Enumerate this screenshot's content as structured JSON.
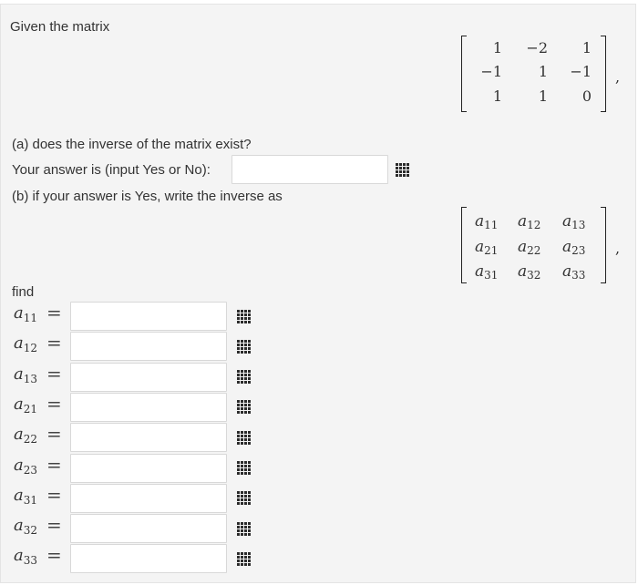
{
  "prompt": "Given the matrix",
  "matrix": {
    "rows": [
      [
        "1",
        "−2",
        "1"
      ],
      [
        "−1",
        "1",
        "−1"
      ],
      [
        "1",
        "1",
        "0"
      ]
    ],
    "trailing": ","
  },
  "part_a": {
    "question": "(a) does the inverse of the matrix exist?",
    "label": "Your answer is (input Yes or No):",
    "value": ""
  },
  "part_b": {
    "text": "(b) if your answer is Yes, write the inverse as"
  },
  "inverse_matrix": {
    "rows": [
      [
        {
          "b": "a",
          "s": "11"
        },
        {
          "b": "a",
          "s": "12"
        },
        {
          "b": "a",
          "s": "13"
        }
      ],
      [
        {
          "b": "a",
          "s": "21"
        },
        {
          "b": "a",
          "s": "22"
        },
        {
          "b": "a",
          "s": "23"
        }
      ],
      [
        {
          "b": "a",
          "s": "31"
        },
        {
          "b": "a",
          "s": "32"
        },
        {
          "b": "a",
          "s": "33"
        }
      ]
    ],
    "trailing": ","
  },
  "find_label": "find",
  "entries": [
    {
      "base": "a",
      "sub": "11",
      "eq": "=",
      "value": ""
    },
    {
      "base": "a",
      "sub": "12",
      "eq": "=",
      "value": ""
    },
    {
      "base": "a",
      "sub": "13",
      "eq": "=",
      "value": ""
    },
    {
      "base": "a",
      "sub": "21",
      "eq": "=",
      "value": ""
    },
    {
      "base": "a",
      "sub": "22",
      "eq": "=",
      "value": ""
    },
    {
      "base": "a",
      "sub": "23",
      "eq": "=",
      "value": ""
    },
    {
      "base": "a",
      "sub": "31",
      "eq": "=",
      "value": ""
    },
    {
      "base": "a",
      "sub": "32",
      "eq": "=",
      "value": ""
    },
    {
      "base": "a",
      "sub": "33",
      "eq": "=",
      "value": ""
    }
  ],
  "icons": {
    "keypad": "keypad-grid-icon"
  }
}
